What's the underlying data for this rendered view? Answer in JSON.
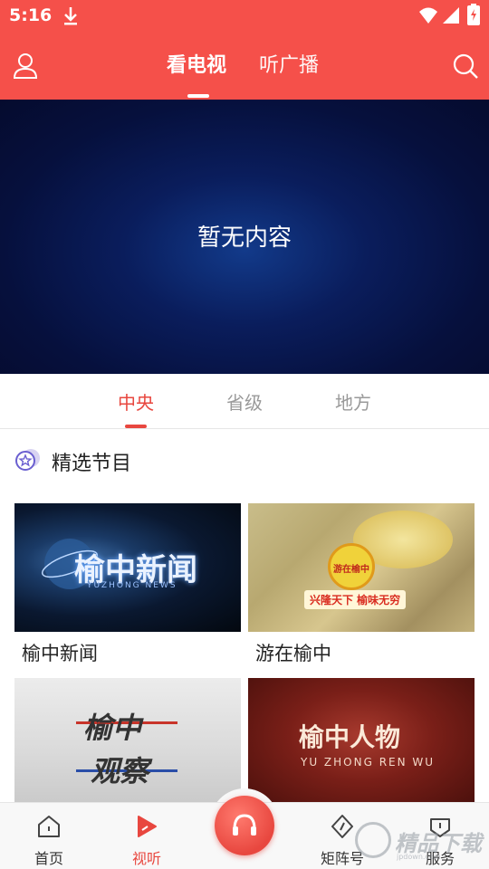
{
  "status_bar": {
    "time": "5:16"
  },
  "header": {
    "tabs": [
      {
        "label": "看电视",
        "active": true
      },
      {
        "label": "听广播",
        "active": false
      }
    ],
    "accent_color": "#f5504a"
  },
  "player": {
    "empty_text": "暂无内容"
  },
  "category_tabs": [
    {
      "label": "中央",
      "active": true
    },
    {
      "label": "省级",
      "active": false
    },
    {
      "label": "地方",
      "active": false
    }
  ],
  "section": {
    "title": "精选节目",
    "icon": "star-badge-icon"
  },
  "programs": [
    {
      "title": "榆中新闻",
      "logo_text": "榆中新闻",
      "logo_sub": "YUZHONG NEWS"
    },
    {
      "title": "游在榆中",
      "logo_text": "游在榆中",
      "banner_text": "兴隆天下 榆味无穷"
    },
    {
      "title": "",
      "logo_text": "榆中",
      "logo_text_2": "观察"
    },
    {
      "title": "",
      "logo_text": "榆中人物",
      "logo_sub": "YU ZHONG REN WU"
    }
  ],
  "bottom_nav": [
    {
      "label": "首页",
      "icon": "home-icon",
      "active": false
    },
    {
      "label": "视听",
      "icon": "play-icon",
      "active": true
    },
    {
      "label": "",
      "icon": "headset-icon",
      "active": false
    },
    {
      "label": "矩阵号",
      "icon": "compass-icon",
      "active": false
    },
    {
      "label": "服务",
      "icon": "service-icon",
      "active": false
    }
  ],
  "watermark": {
    "text": "精品下载",
    "url": "jpdown.com"
  }
}
